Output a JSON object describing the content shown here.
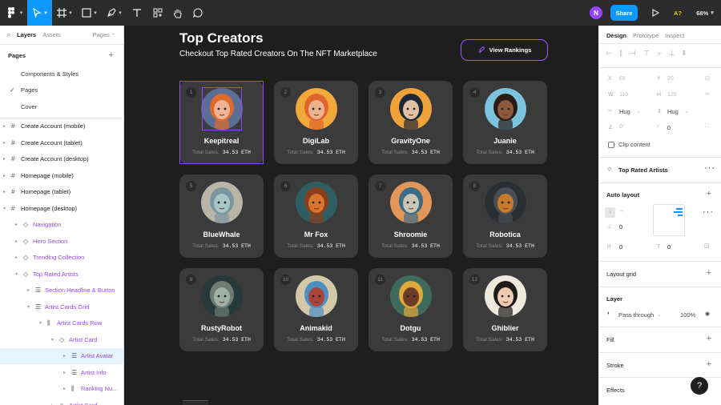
{
  "toolbar": {
    "avatar_initial": "N",
    "share_label": "Share",
    "font_badge": "A?",
    "zoom": "68%"
  },
  "left_panel": {
    "tabs": [
      "Layers",
      "Assets"
    ],
    "pages_label": "Pages",
    "pages_title": "Pages",
    "pages": [
      "Components & Styles",
      "Pages",
      "Cover"
    ],
    "current_page": "Pages",
    "layers": [
      {
        "label": "Create Account (mobile)",
        "indent": 0,
        "kind": "frame"
      },
      {
        "label": "Create Account (tablet)",
        "indent": 0,
        "kind": "frame"
      },
      {
        "label": "Create Account (desktop)",
        "indent": 0,
        "kind": "frame"
      },
      {
        "label": "Homepage (mobile)",
        "indent": 0,
        "kind": "frame"
      },
      {
        "label": "Homepage (tablet)",
        "indent": 0,
        "kind": "frame"
      },
      {
        "label": "Homepage (desktop)",
        "indent": 0,
        "kind": "frame"
      },
      {
        "label": "Navigation",
        "indent": 1,
        "kind": "instance"
      },
      {
        "label": "Hero Section",
        "indent": 1,
        "kind": "instance"
      },
      {
        "label": "Trending Collection",
        "indent": 1,
        "kind": "instance"
      },
      {
        "label": "Top Rated Artists",
        "indent": 1,
        "kind": "instance"
      },
      {
        "label": "Section Headline & Button",
        "indent": 2,
        "kind": "autolayout-v"
      },
      {
        "label": "Artist Cards Grid",
        "indent": 2,
        "kind": "autolayout-v"
      },
      {
        "label": "Artist Cards Row",
        "indent": 3,
        "kind": "autolayout-h"
      },
      {
        "label": "Artist Card",
        "indent": 4,
        "kind": "instance"
      },
      {
        "label": "Artist Avatar",
        "indent": 5,
        "kind": "autolayout-v",
        "selected": true
      },
      {
        "label": "Artist Info",
        "indent": 5,
        "kind": "autolayout-v"
      },
      {
        "label": "Ranking Nu...",
        "indent": 5,
        "kind": "autolayout-h"
      },
      {
        "label": "Artist Card",
        "indent": 4,
        "kind": "instance"
      }
    ]
  },
  "canvas": {
    "title": "Top Creators",
    "subtitle": "Checkout Top Rated Creators On The NFT Marketplace",
    "button_label": "View Rankings",
    "sales_label": "Total Sales:",
    "cards": [
      {
        "rank": "1",
        "name": "Keepitreal",
        "sales": "34.53 ETH",
        "bg": "#5a6f95",
        "skin": "#f0b393",
        "hair": "#e06a2c"
      },
      {
        "rank": "2",
        "name": "DigiLab",
        "sales": "34.53 ETH",
        "bg": "#f2a93b",
        "skin": "#efb28f",
        "hair": "#e0642e"
      },
      {
        "rank": "3",
        "name": "GravityOne",
        "sales": "34.53 ETH",
        "bg": "#f0a33a",
        "skin": "#e2c2a6",
        "hair": "#1f2a38"
      },
      {
        "rank": "4",
        "name": "Juanie",
        "sales": "34.53 ETH",
        "bg": "#7cc4dd",
        "skin": "#8e5a3e",
        "hair": "#2a1b17"
      },
      {
        "rank": "5",
        "name": "BlueWhale",
        "sales": "34.53 ETH",
        "bg": "#b9b6a7",
        "skin": "#a8c6c4",
        "hair": "#7b95a1"
      },
      {
        "rank": "6",
        "name": "Mr Fox",
        "sales": "34.53 ETH",
        "bg": "#2e5e62",
        "skin": "#d9752e",
        "hair": "#8a3d1d"
      },
      {
        "rank": "7",
        "name": "Shroomie",
        "sales": "34.53 ETH",
        "bg": "#e3965a",
        "skin": "#c9c7b4",
        "hair": "#3c6b86"
      },
      {
        "rank": "8",
        "name": "Robotica",
        "sales": "34.53 ETH",
        "bg": "#2b2f33",
        "skin": "#c67b2c",
        "hair": "#4a4f55"
      },
      {
        "rank": "9",
        "name": "RustyRobot",
        "sales": "34.53 ETH",
        "bg": "#27393a",
        "skin": "#9fb0a6",
        "hair": "#6f7b73"
      },
      {
        "rank": "10",
        "name": "Animakid",
        "sales": "34.53 ETH",
        "bg": "#d3c9a9",
        "skin": "#a9463c",
        "hair": "#4d8fc4"
      },
      {
        "rank": "11",
        "name": "Dotgu",
        "sales": "34.53 ETH",
        "bg": "#3f6a5e",
        "skin": "#6e3d28",
        "hair": "#e1a83a"
      },
      {
        "rank": "12",
        "name": "Ghiblier",
        "sales": "34.53 ETH",
        "bg": "#eee9dc",
        "skin": "#f1cbb1",
        "hair": "#1c1c1c"
      }
    ]
  },
  "right_panel": {
    "tabs": [
      "Design",
      "Prototype",
      "Inspect"
    ],
    "x_label": "X",
    "x_value": "65",
    "y_label": "Y",
    "y_value": "20",
    "w_label": "W",
    "w_value": "110",
    "h_label": "H",
    "h_value": "120",
    "hug_w": "Hug",
    "hug_h": "Hug",
    "rotation": "0°",
    "radius": "0",
    "clip_content": "Clip content",
    "component_name": "Top Rated Artists",
    "auto_layout": "Auto layout",
    "spacing": "0",
    "padding_h": "0",
    "padding_v": "0",
    "layout_grid": "Layout grid",
    "layer": "Layer",
    "blend": "Pass through",
    "opacity": "100%",
    "fill": "Fill",
    "stroke": "Stroke",
    "effects": "Effects"
  },
  "help_label": "?"
}
